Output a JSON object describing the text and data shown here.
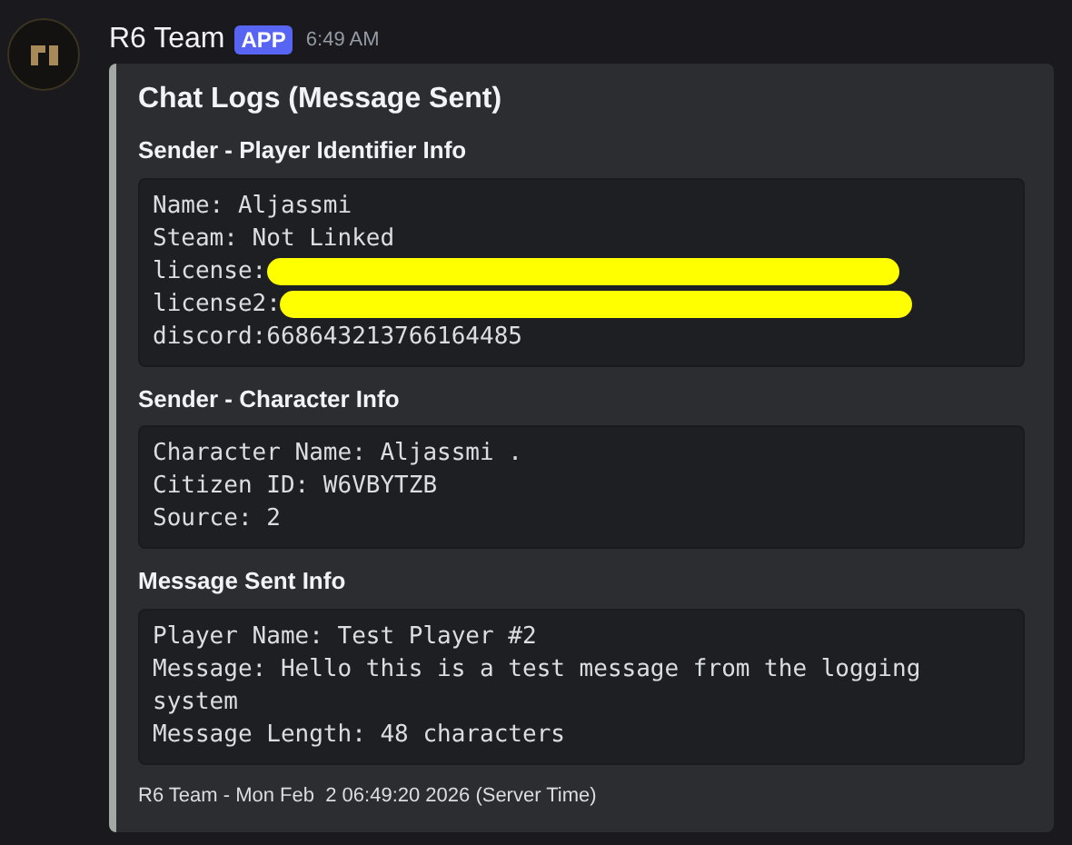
{
  "message": {
    "author": "R6 Team",
    "badge": "APP",
    "time": "6:49 AM"
  },
  "embed": {
    "title": "Chat Logs (Message Sent)",
    "fields": [
      {
        "name": "Sender - Player Identifier Info",
        "lines": [
          {
            "text": "Name: Aljassmi",
            "redacted": false
          },
          {
            "text": "Steam: Not Linked",
            "redacted": false
          },
          {
            "text": "license:",
            "redacted": true
          },
          {
            "text": "license2:",
            "redacted": true
          },
          {
            "text": "discord:668643213766164485",
            "redacted": false
          }
        ]
      },
      {
        "name": "Sender - Character Info",
        "lines": [
          {
            "text": "Character Name: Aljassmi .",
            "redacted": false
          },
          {
            "text": "Citizen ID: W6VBYTZB",
            "redacted": false
          },
          {
            "text": "Source: 2",
            "redacted": false
          }
        ]
      },
      {
        "name": "Message Sent Info",
        "lines": [
          {
            "text": "Player Name: Test Player #2",
            "redacted": false
          },
          {
            "text": "Message: Hello this is a test message from the logging system",
            "redacted": false
          },
          {
            "text": "Message Length: 48 characters",
            "redacted": false
          }
        ]
      }
    ],
    "footer": "R6 Team - Mon Feb  2 06:49:20 2026 (Server Time)"
  }
}
